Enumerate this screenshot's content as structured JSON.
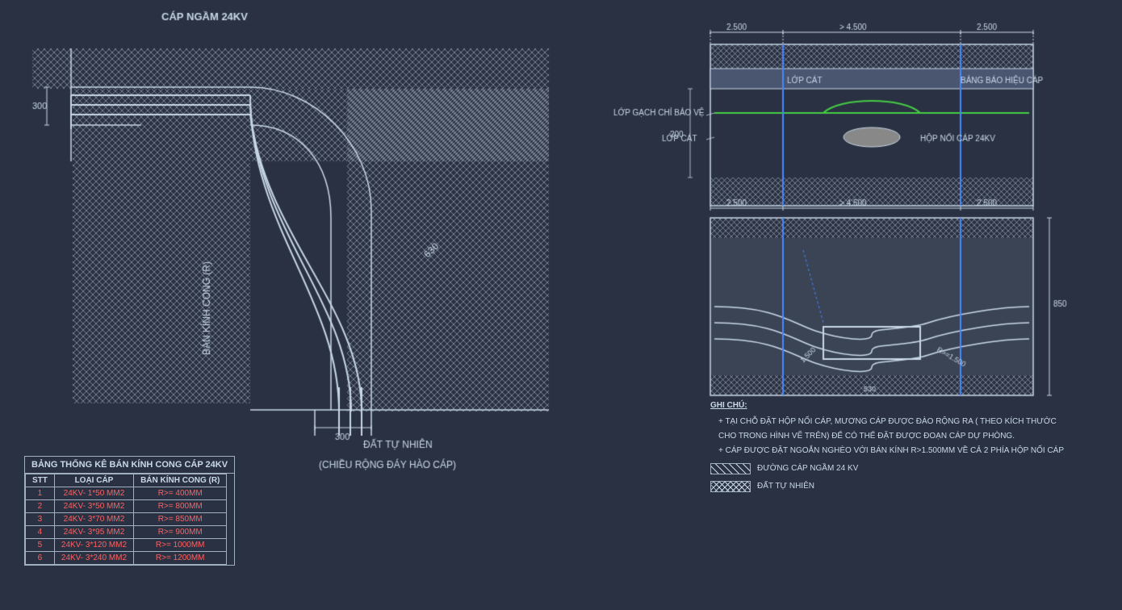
{
  "title": "CAP NGAM 24KV - BANG THONG KE BAN KINH CONG",
  "main_label": "CÁP NGẦM 24KV",
  "dimension_300_left": "300",
  "dimension_300_bottom": "300",
  "label_dat_tu_nhien": "ĐẤT TỰ NHIÊN",
  "label_ban_kinh_cong": "BÁN KÍNH CONG (R)",
  "label_630": "630",
  "label_chieu_rong": "(CHIỀU RỘNG ĐÁY HÀO CÁP)",
  "right_panel": {
    "dim_2500_left": "2.500",
    "dim_4500_mid": "> 4.500",
    "dim_2500_right": "2.500",
    "dim_2500_left2": "2.500",
    "dim_4500_mid2": "> 4.500",
    "dim_2500_right2": "2.500",
    "dim_200": "200",
    "dim_850": "850",
    "dim_1500_left": "1.500",
    "dim_1500_right": "R>=1.500",
    "dim_530": "530",
    "label_lop_cat_top": "LỚP CÁT",
    "label_bang_bao_hieu": "BẢNG BÁO HIỆU CÁP",
    "label_lop_gach": "LỚP GẠCH CHỈ BẢO VỆ",
    "label_lop_cat_mid": "LỚP CÁT",
    "label_hop_noi": "HỘP NỐI CÁP 24KV"
  },
  "notes": {
    "title": "GHI CHÚ:",
    "note1": "+ TẠI CHỖ ĐẶT HỘP NỐI CÁP, MƯƠNG CÁP ĐƯỢC ĐÀO RỘNG RA ( THEO KÍCH THƯỚC",
    "note1b": "    CHO TRONG HÌNH VẼ TRÊN) ĐỂ CÓ THỂ ĐẶT ĐƯỢC ĐOẠN CÁP DỰ PHÒNG.",
    "note2": "+ CÁP ĐƯỢC ĐẶT NGOẮN NGHÈO VỚI BÁN KÍNH R>1.500MM VỀ CẢ 2 PHÍA HỘP NỐI CÁP",
    "legend1": "ĐƯỜNG CÁP NGẦM 24 KV",
    "legend2": "ĐẤT TỰ NHIÊN"
  },
  "table": {
    "title": "BẢNG THỐNG KÊ BÁN KÍNH CONG CÁP 24KV",
    "headers": [
      "STT",
      "LOẠI CÁP",
      "BÁN KÍNH CONG (R)"
    ],
    "rows": [
      {
        "stt": "1",
        "loai": "24KV- 1*50 MM2",
        "bkc": "R>= 400MM"
      },
      {
        "stt": "2",
        "loai": "24KV- 3*50 MM2",
        "bkc": "R>= 800MM"
      },
      {
        "stt": "3",
        "loai": "24KV- 3*70 MM2",
        "bkc": "R>= 850MM"
      },
      {
        "stt": "4",
        "loai": "24KV- 3*95 MM2",
        "bkc": "R>= 900MM"
      },
      {
        "stt": "5",
        "loai": "24KV- 3*120 MM2",
        "bkc": "R>= 1000MM"
      },
      {
        "stt": "6",
        "loai": "24KV- 3*240 MM2",
        "bkc": "R>= 1200MM"
      }
    ]
  }
}
